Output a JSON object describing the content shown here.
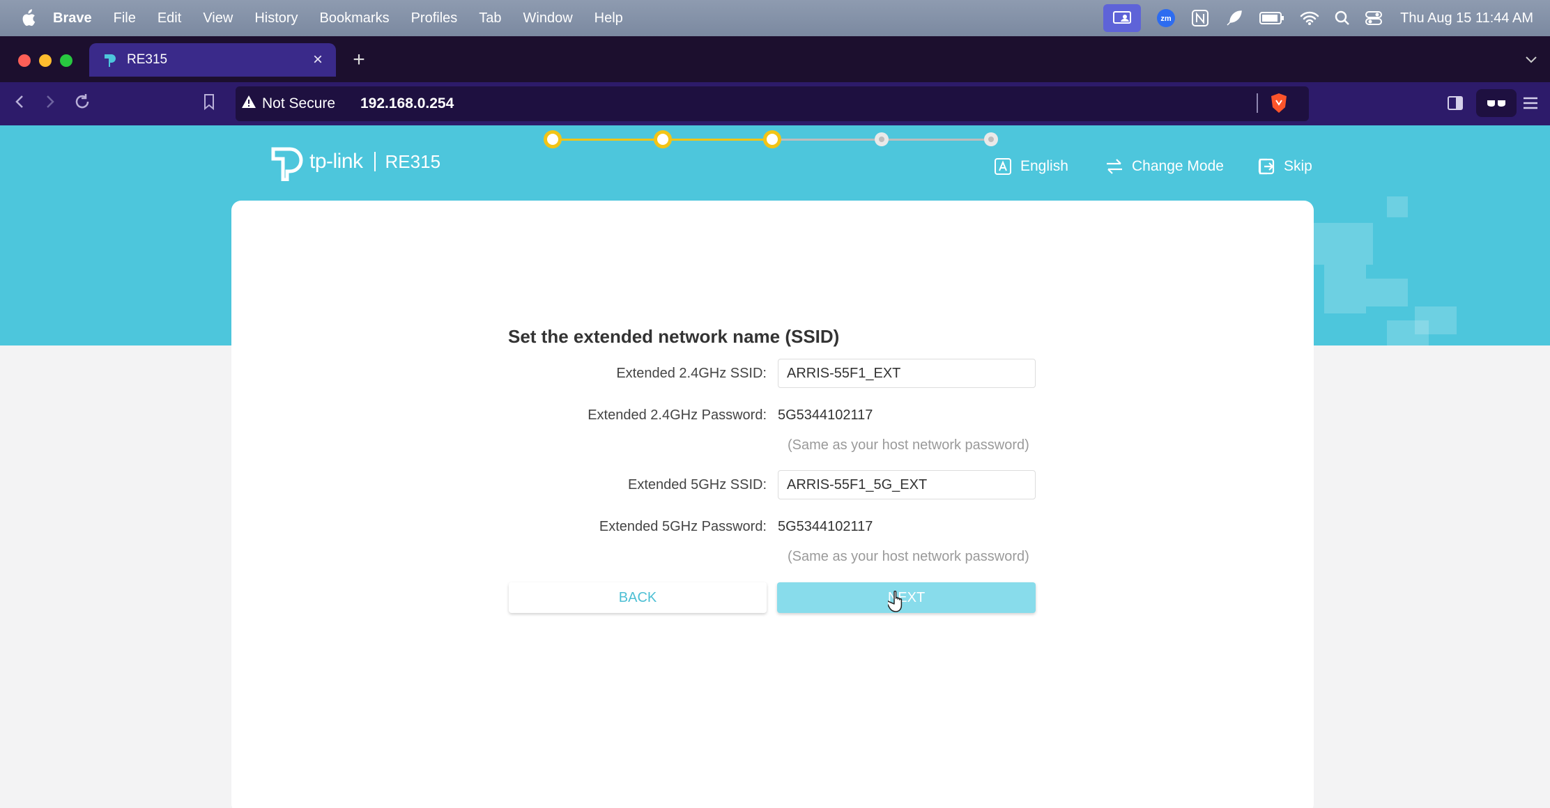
{
  "menubar": {
    "app_name": "Brave",
    "items": [
      "File",
      "Edit",
      "View",
      "History",
      "Bookmarks",
      "Profiles",
      "Tab",
      "Window",
      "Help"
    ],
    "clock": "Thu Aug 15  11:44 AM",
    "status_icons": [
      "screen-share-icon",
      "zoom-icon",
      "notion-icon",
      "feather-icon",
      "battery-icon",
      "wifi-icon",
      "spotlight-search-icon",
      "control-center-icon"
    ]
  },
  "browser": {
    "tab_title": "RE315",
    "security_label": "Not Secure",
    "url": "192.168.0.254"
  },
  "header": {
    "logo_text": "tp-link",
    "model": "RE315",
    "actions": {
      "language": "English",
      "change_mode": "Change Mode",
      "skip": "Skip"
    }
  },
  "stepper": {
    "total_steps": 5,
    "completed_steps": 3
  },
  "form": {
    "heading": "Set the extended network name (SSID)",
    "ssid24_label": "Extended 2.4GHz SSID:",
    "ssid24_value": "ARRIS-55F1_EXT",
    "pass24_label": "Extended 2.4GHz Password:",
    "pass24_value": "5G5344102117",
    "pass24_note": "(Same as your host network password)",
    "ssid5_label": "Extended 5GHz SSID:",
    "ssid5_value": "ARRIS-55F1_5G_EXT",
    "pass5_label": "Extended 5GHz Password:",
    "pass5_value": "5G5344102117",
    "pass5_note": "(Same as your host network password)"
  },
  "buttons": {
    "back": "BACK",
    "next": "NEXT"
  },
  "colors": {
    "banner": "#4dc6dc",
    "accent_yellow": "#f2c416",
    "next_button": "#88dceb",
    "browser_toolbar": "#2d1b6a"
  }
}
